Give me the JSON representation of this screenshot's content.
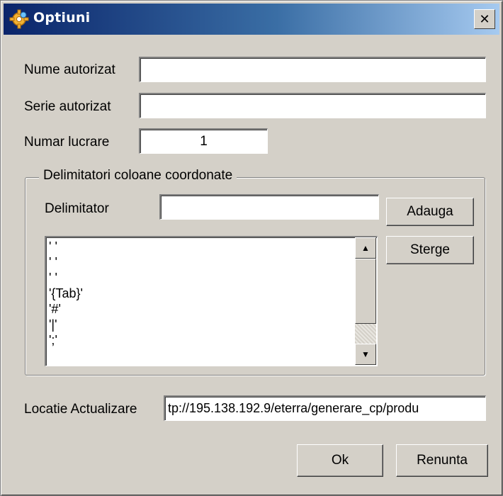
{
  "window": {
    "title": "Optiuni",
    "close_glyph": "✕",
    "icon": "gear-icon"
  },
  "form": {
    "nume_label": "Nume autorizat",
    "nume_value": "",
    "serie_label": "Serie autorizat",
    "serie_value": "",
    "numar_label": "Numar lucrare",
    "numar_value": "1"
  },
  "delimiters": {
    "group_title": "Delimitatori coloane coordonate",
    "delimitator_label": "Delimitator",
    "delimitator_value": "",
    "add_label": "Adauga",
    "remove_label": "Sterge",
    "items": [
      "' '",
      "' '",
      "' '",
      "'{Tab}'",
      "'#'",
      "'|'",
      "';'"
    ]
  },
  "update": {
    "label": "Locatie Actualizare",
    "value": "tp://195.138.192.9/eterra/generare_cp/produ"
  },
  "buttons": {
    "ok_label": "Ok",
    "cancel_label": "Renunta"
  },
  "colors": {
    "titlebar_start": "#0a246a",
    "titlebar_end": "#a6caf0",
    "face": "#d4d0c8"
  }
}
